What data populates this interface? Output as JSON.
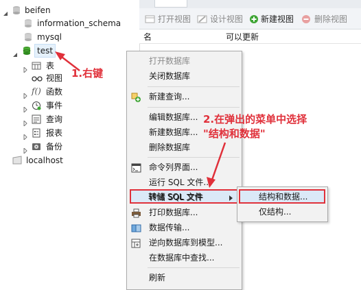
{
  "tree": {
    "nodes": [
      {
        "label": "beifen"
      },
      {
        "label": "information_schema"
      },
      {
        "label": "mysql"
      },
      {
        "label": "test"
      },
      {
        "label": "表"
      },
      {
        "label": "视图"
      },
      {
        "label": "函数"
      },
      {
        "label": "事件"
      },
      {
        "label": "查询"
      },
      {
        "label": "报表"
      },
      {
        "label": "备份"
      },
      {
        "label": "localhost"
      }
    ]
  },
  "toolbar": {
    "open_view": "打开视图",
    "design_view": "设计视图",
    "new_view": "新建视图",
    "delete_view": "删除视图"
  },
  "columns": {
    "name": "名",
    "updatable": "可以更新"
  },
  "menu": {
    "items": [
      "打开数据库",
      "关闭数据库",
      "新建查询...",
      "编辑数据库...",
      "新建数据库...",
      "删除数据库",
      "命令列界面...",
      "运行 SQL 文件...",
      "转储 SQL 文件",
      "打印数据库...",
      "数据传输...",
      "逆向数据库到模型...",
      "在数据库中查找...",
      "刷新"
    ]
  },
  "submenu": {
    "items": [
      "结构和数据...",
      "仅结构..."
    ]
  },
  "annotations": {
    "step1": "1.右键",
    "step2_line1": "2.在弹出的菜单中选择",
    "step2_line2": "\"结构和数据\""
  },
  "colors": {
    "accent": "#e0303a",
    "selection": "#dbe9f7"
  }
}
